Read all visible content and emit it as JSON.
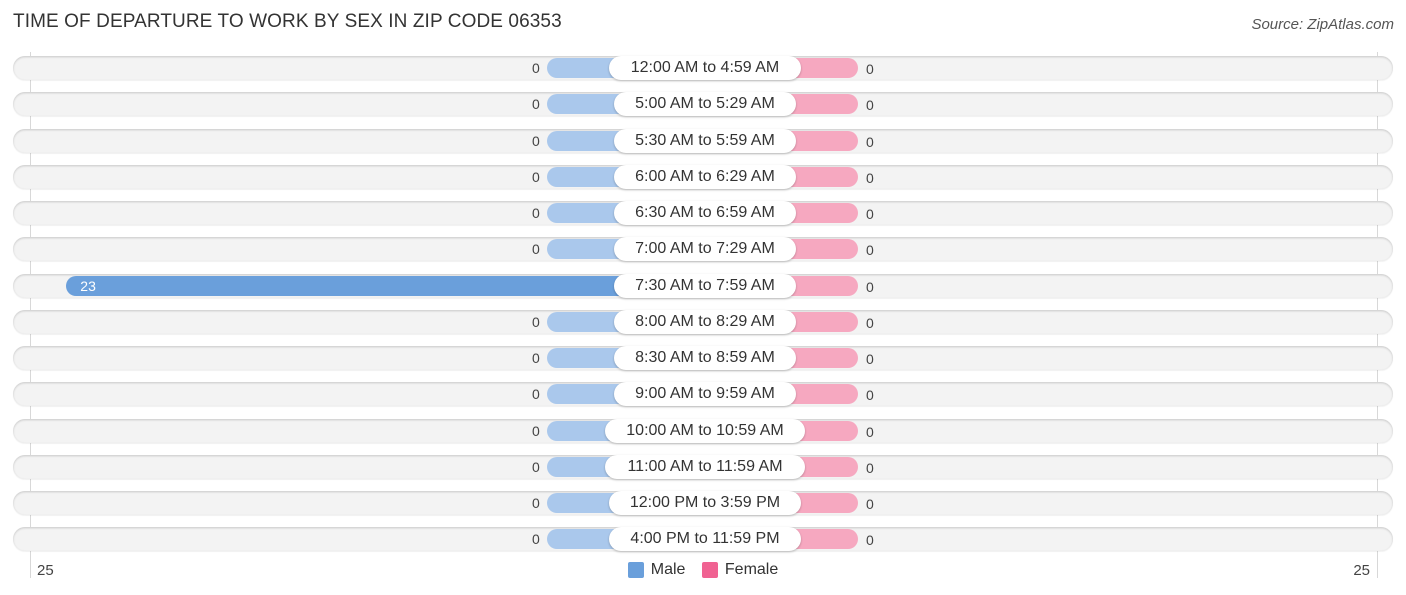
{
  "header": {
    "title": "TIME OF DEPARTURE TO WORK BY SEX IN ZIP CODE 06353",
    "source": "Source: ZipAtlas.com"
  },
  "colors": {
    "male": "#aac8ec",
    "male_highlight": "#6a9fdb",
    "female": "#f6a8c0",
    "legend_male": "#6a9fdb",
    "legend_female": "#f06292"
  },
  "chart_data": {
    "type": "bar",
    "orientation": "horizontal-diverging",
    "title": "TIME OF DEPARTURE TO WORK BY SEX IN ZIP CODE 06353",
    "categories": [
      "12:00 AM to 4:59 AM",
      "5:00 AM to 5:29 AM",
      "5:30 AM to 5:59 AM",
      "6:00 AM to 6:29 AM",
      "6:30 AM to 6:59 AM",
      "7:00 AM to 7:29 AM",
      "7:30 AM to 7:59 AM",
      "8:00 AM to 8:29 AM",
      "8:30 AM to 8:59 AM",
      "9:00 AM to 9:59 AM",
      "10:00 AM to 10:59 AM",
      "11:00 AM to 11:59 AM",
      "12:00 PM to 3:59 PM",
      "4:00 PM to 11:59 PM"
    ],
    "series": [
      {
        "name": "Male",
        "values": [
          0,
          0,
          0,
          0,
          0,
          0,
          23,
          0,
          0,
          0,
          0,
          0,
          0,
          0
        ]
      },
      {
        "name": "Female",
        "values": [
          0,
          0,
          0,
          0,
          0,
          0,
          0,
          0,
          0,
          0,
          0,
          0,
          0,
          0
        ]
      }
    ],
    "axis": {
      "min_label": "25",
      "max_label": "25",
      "range": [
        0,
        25
      ]
    },
    "legend": {
      "position": "bottom-center",
      "entries": [
        "Male",
        "Female"
      ]
    }
  }
}
